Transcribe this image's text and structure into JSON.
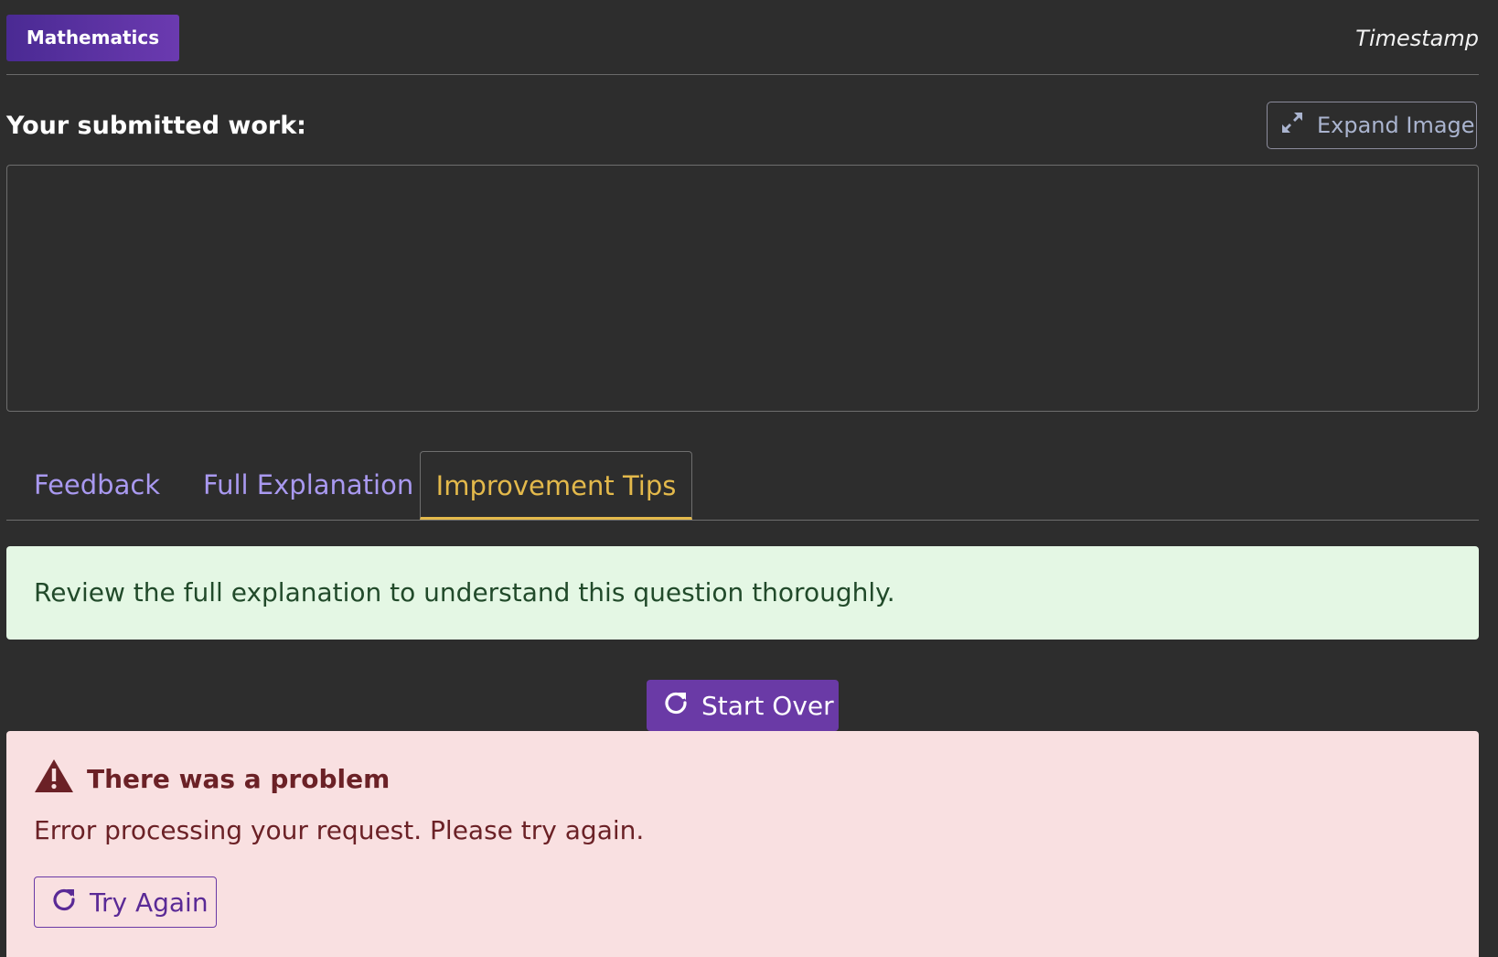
{
  "header": {
    "subject_badge": "Mathematics",
    "timestamp": "Timestamp"
  },
  "submitted_work": {
    "title": "Your submitted work:",
    "expand_label": "Expand Image"
  },
  "tabs": [
    {
      "label": "Feedback",
      "active": false
    },
    {
      "label": "Full Explanation",
      "active": false
    },
    {
      "label": "Improvement Tips",
      "active": true
    }
  ],
  "tip": {
    "text": "Review the full explanation to understand this question thoroughly."
  },
  "actions": {
    "start_over_label": "Start Over"
  },
  "error": {
    "heading": "There was a problem",
    "message": "Error processing your request. Please try again.",
    "retry_label": "Try Again"
  },
  "colors": {
    "background": "#2d2d2d",
    "accent_purple": "#6a3aa6",
    "tab_inactive": "#a999f0",
    "tab_active": "#e3b94b",
    "tip_background": "#e4f7e4",
    "error_background": "#f9e0e1",
    "error_text": "#6b2126"
  },
  "icons": {
    "expand": "expand-icon",
    "refresh": "refresh-icon",
    "warning": "warning-triangle-icon"
  }
}
